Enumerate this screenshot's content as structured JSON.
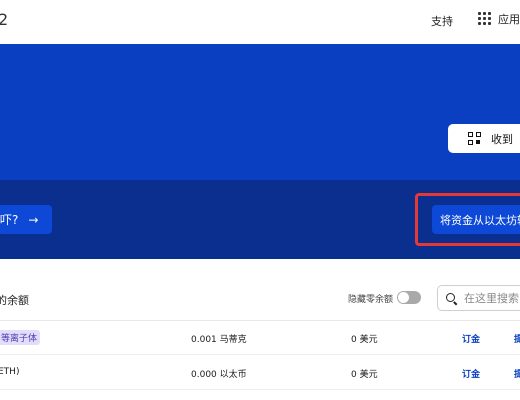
{
  "topbar": {
    "title_fragment": "2",
    "support_label": "支持",
    "apps_label": "应用"
  },
  "hero": {
    "receive_label": "收到"
  },
  "band": {
    "left_button_text": "吓?",
    "right_button_text": "将资金从以太坊转"
  },
  "assets": {
    "title": "的余额",
    "hide_zero_label": "隐藏零余额",
    "hide_zero_enabled": false,
    "search_placeholder": "在这里搜索",
    "rows": [
      {
        "name": "等离子体",
        "amount": "0.001 马蒂克",
        "usd": "0 美元",
        "fund": "订金",
        "more": "提"
      },
      {
        "name": "ETH)",
        "amount": "0.000 以太币",
        "usd": "0 美元",
        "fund": "订金",
        "more": "提"
      }
    ]
  },
  "colors": {
    "hero_blue": "#0a3fc2",
    "band_blue": "#0a2f8e",
    "button_blue": "#0d49d6",
    "highlight_red": "#e53935",
    "badge_bg": "#e3ddfb"
  }
}
